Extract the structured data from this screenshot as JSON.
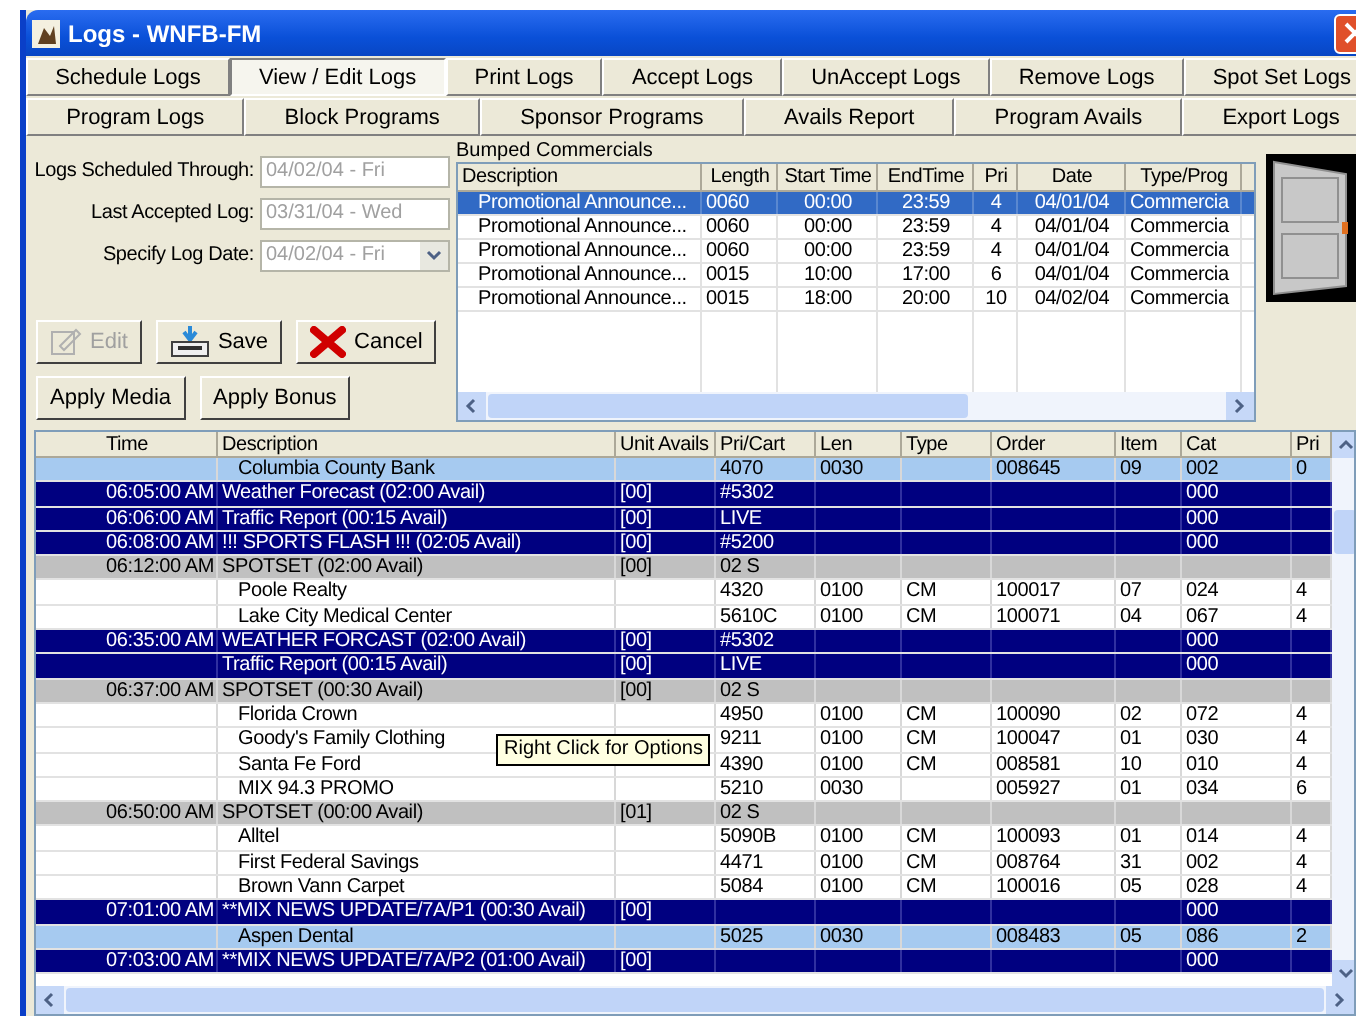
{
  "window": {
    "title": "Logs - WNFB-FM"
  },
  "tabs_row_1": [
    {
      "label": "Schedule Logs",
      "selected": false
    },
    {
      "label": "View / Edit Logs",
      "selected": true
    },
    {
      "label": "Print Logs",
      "selected": false
    },
    {
      "label": "Accept Logs",
      "selected": false
    },
    {
      "label": "UnAccept Logs",
      "selected": false
    },
    {
      "label": "Remove Logs",
      "selected": false
    },
    {
      "label": "Spot Set Logs",
      "selected": false
    }
  ],
  "tabs_row_2": [
    {
      "label": "Program Logs",
      "selected": false
    },
    {
      "label": "Block Programs",
      "selected": false
    },
    {
      "label": "Sponsor Programs",
      "selected": false
    },
    {
      "label": "Avails Report",
      "selected": false
    },
    {
      "label": "Program Avails",
      "selected": false
    },
    {
      "label": "Export Logs",
      "selected": false
    }
  ],
  "form": [
    {
      "label": "Logs Scheduled Through:",
      "value": "04/02/04 - Fri",
      "kind": "text",
      "disabled": true
    },
    {
      "label": "Last Accepted Log:",
      "value": "03/31/04 - Wed",
      "kind": "text",
      "disabled": true
    },
    {
      "label": "Specify Log Date:",
      "value": "04/02/04 - Fri",
      "kind": "dropdown",
      "disabled": true
    }
  ],
  "buttons": [
    {
      "label": "Edit",
      "kind": "edit",
      "disabled": true
    },
    {
      "label": "Save",
      "kind": "save",
      "disabled": false
    },
    {
      "label": "Cancel",
      "kind": "cancel",
      "disabled": false
    },
    {
      "label": "Apply Media",
      "kind": "plain",
      "disabled": false
    },
    {
      "label": "Apply Bonus",
      "kind": "plain",
      "disabled": false
    }
  ],
  "bumped_commercials": {
    "title": "Bumped Commercials",
    "columns": [
      "Description",
      "Length",
      "Start Time",
      "EndTime",
      "Pri",
      "Date",
      "Type/Prog"
    ],
    "rows": [
      {
        "selected": true,
        "cells": [
          "Promotional Announce...",
          "0060",
          "00:00",
          "23:59",
          "4",
          "04/01/04",
          "Commercia"
        ]
      },
      {
        "selected": false,
        "cells": [
          "Promotional Announce...",
          "0060",
          "00:00",
          "23:59",
          "4",
          "04/01/04",
          "Commercia"
        ]
      },
      {
        "selected": false,
        "cells": [
          "Promotional Announce...",
          "0060",
          "00:00",
          "23:59",
          "4",
          "04/01/04",
          "Commercia"
        ]
      },
      {
        "selected": false,
        "cells": [
          "Promotional Announce...",
          "0015",
          "10:00",
          "17:00",
          "6",
          "04/01/04",
          "Commercia"
        ]
      },
      {
        "selected": false,
        "cells": [
          "Promotional Announce...",
          "0015",
          "18:00",
          "20:00",
          "10",
          "04/02/04",
          "Commercia"
        ]
      }
    ]
  },
  "log": {
    "columns": [
      "Time",
      "Description",
      "Unit Avails",
      "Pri/Cart",
      "Len",
      "Type",
      "Order",
      "Item",
      "Cat",
      "Pri"
    ],
    "rows": [
      {
        "kind": "highlight",
        "cells": [
          "",
          "Columbia County Bank",
          "",
          "4070",
          "0030",
          "",
          "008645",
          "09",
          "002",
          "0"
        ]
      },
      {
        "kind": "event",
        "cells": [
          "06:05:00 AM",
          "Weather Forecast (02:00 Avail)",
          "[00]",
          "#5302",
          "",
          "",
          "",
          "",
          "000",
          ""
        ]
      },
      {
        "kind": "event",
        "cells": [
          "06:06:00 AM",
          "Traffic Report (00:15 Avail)",
          "[00]",
          "LIVE",
          "",
          "",
          "",
          "",
          "000",
          ""
        ]
      },
      {
        "kind": "event",
        "cells": [
          "06:08:00 AM",
          "!!! SPORTS FLASH !!! (02:05 Avail)",
          "[00]",
          "#5200",
          "",
          "",
          "",
          "",
          "000",
          ""
        ]
      },
      {
        "kind": "spotset",
        "cells": [
          "06:12:00 AM",
          "SPOTSET (02:00 Avail)",
          "[00]",
          "02 S",
          "",
          "",
          "",
          "",
          "",
          ""
        ]
      },
      {
        "kind": "spot",
        "cells": [
          "",
          "Poole Realty",
          "",
          "4320",
          "0100",
          "CM",
          "100017",
          "07",
          "024",
          "4"
        ]
      },
      {
        "kind": "spot",
        "cells": [
          "",
          "Lake City Medical Center",
          "",
          "5610C",
          "0100",
          "CM",
          "100071",
          "04",
          "067",
          "4"
        ]
      },
      {
        "kind": "event",
        "cells": [
          "06:35:00 AM",
          "WEATHER FORCAST (02:00 Avail)",
          "[00]",
          "#5302",
          "",
          "",
          "",
          "",
          "000",
          ""
        ]
      },
      {
        "kind": "event",
        "cells": [
          "",
          "Traffic Report (00:15 Avail)",
          "[00]",
          "LIVE",
          "",
          "",
          "",
          "",
          "000",
          ""
        ]
      },
      {
        "kind": "spotset",
        "cells": [
          "06:37:00 AM",
          "SPOTSET (00:30 Avail)",
          "[00]",
          "02 S",
          "",
          "",
          "",
          "",
          "",
          ""
        ]
      },
      {
        "kind": "spot",
        "cells": [
          "",
          "Florida Crown",
          "",
          "4950",
          "0100",
          "CM",
          "100090",
          "02",
          "072",
          "4"
        ]
      },
      {
        "kind": "spot",
        "cells": [
          "",
          "Goody's Family Clothing",
          "",
          "9211",
          "0100",
          "CM",
          "100047",
          "01",
          "030",
          "4"
        ]
      },
      {
        "kind": "spot",
        "cells": [
          "",
          "Santa Fe Ford",
          "",
          "4390",
          "0100",
          "CM",
          "008581",
          "10",
          "010",
          "4"
        ]
      },
      {
        "kind": "spot",
        "cells": [
          "",
          "MIX 94.3 PROMO",
          "",
          "5210",
          "0030",
          "",
          "005927",
          "01",
          "034",
          "6"
        ]
      },
      {
        "kind": "spotset",
        "cells": [
          "06:50:00 AM",
          "SPOTSET (00:00 Avail)",
          "[01]",
          "02 S",
          "",
          "",
          "",
          "",
          "",
          ""
        ]
      },
      {
        "kind": "spot",
        "cells": [
          "",
          "Alltel",
          "",
          "5090B",
          "0100",
          "CM",
          "100093",
          "01",
          "014",
          "4"
        ]
      },
      {
        "kind": "spot",
        "cells": [
          "",
          "First Federal Savings",
          "",
          "4471",
          "0100",
          "CM",
          "008764",
          "31",
          "002",
          "4"
        ]
      },
      {
        "kind": "spot",
        "cells": [
          "",
          "Brown Vann Carpet",
          "",
          "5084",
          "0100",
          "CM",
          "100016",
          "05",
          "028",
          "4"
        ]
      },
      {
        "kind": "event",
        "cells": [
          "07:01:00 AM",
          "**MIX NEWS UPDATE/7A/P1 (00:30 Avail)",
          "[00]",
          "",
          "",
          "",
          "",
          "",
          "000",
          ""
        ]
      },
      {
        "kind": "highlight",
        "cells": [
          "",
          "Aspen Dental",
          "",
          "5025",
          "0030",
          "",
          "008483",
          "05",
          "086",
          "2"
        ]
      },
      {
        "kind": "event",
        "cells": [
          "07:03:00 AM",
          "**MIX NEWS UPDATE/7A/P2 (01:00 Avail)",
          "[00]",
          "",
          "",
          "",
          "",
          "",
          "000",
          ""
        ]
      }
    ]
  },
  "tooltip": "Right Click for Options"
}
